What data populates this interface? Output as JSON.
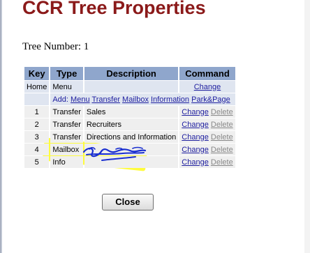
{
  "page": {
    "title": "CCR Tree Properties",
    "tree_number_label": "Tree Number: 1"
  },
  "table": {
    "headers": {
      "key": "Key",
      "type": "Type",
      "description": "Description",
      "command": "Command"
    },
    "home_row": {
      "key": "Home",
      "type": "Menu",
      "description": "",
      "change": "Change"
    },
    "add_row": {
      "label": "Add:",
      "links": [
        "Menu",
        "Transfer",
        "Mailbox",
        "Information",
        "Park&Page"
      ]
    },
    "rows": [
      {
        "key": "1",
        "type": "Transfer",
        "description": "Sales",
        "change": "Change",
        "delete": "Delete"
      },
      {
        "key": "2",
        "type": "Transfer",
        "description": "Recruiters",
        "change": "Change",
        "delete": "Delete"
      },
      {
        "key": "3",
        "type": "Transfer",
        "description": "Directions and Information",
        "change": "Change",
        "delete": "Delete"
      },
      {
        "key": "4",
        "type": "Mailbox",
        "description": "",
        "change": "Change",
        "delete": "Delete"
      },
      {
        "key": "5",
        "type": "Info",
        "description": "",
        "change": "Change",
        "delete": "Delete"
      }
    ]
  },
  "buttons": {
    "close_label": "Close"
  },
  "colors": {
    "title": "#8b1a1a",
    "header_bg": "#8fa6cc",
    "link": "#2020a0",
    "highlight": "#fffb1a",
    "scribble": "#1a2fd0"
  }
}
